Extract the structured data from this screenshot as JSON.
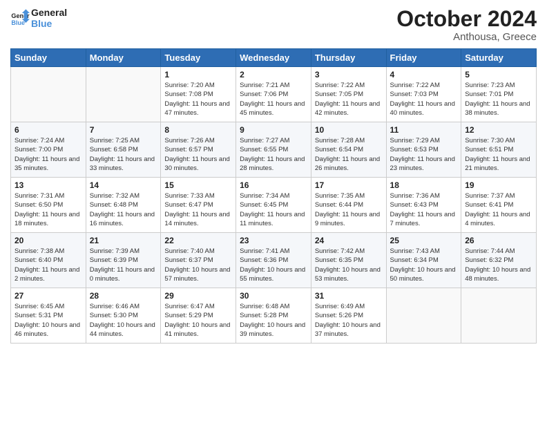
{
  "header": {
    "logo_line1": "General",
    "logo_line2": "Blue",
    "month": "October 2024",
    "location": "Anthousa, Greece"
  },
  "weekdays": [
    "Sunday",
    "Monday",
    "Tuesday",
    "Wednesday",
    "Thursday",
    "Friday",
    "Saturday"
  ],
  "weeks": [
    [
      {
        "day": "",
        "sunrise": "",
        "sunset": "",
        "daylight": ""
      },
      {
        "day": "",
        "sunrise": "",
        "sunset": "",
        "daylight": ""
      },
      {
        "day": "1",
        "sunrise": "Sunrise: 7:20 AM",
        "sunset": "Sunset: 7:08 PM",
        "daylight": "Daylight: 11 hours and 47 minutes."
      },
      {
        "day": "2",
        "sunrise": "Sunrise: 7:21 AM",
        "sunset": "Sunset: 7:06 PM",
        "daylight": "Daylight: 11 hours and 45 minutes."
      },
      {
        "day": "3",
        "sunrise": "Sunrise: 7:22 AM",
        "sunset": "Sunset: 7:05 PM",
        "daylight": "Daylight: 11 hours and 42 minutes."
      },
      {
        "day": "4",
        "sunrise": "Sunrise: 7:22 AM",
        "sunset": "Sunset: 7:03 PM",
        "daylight": "Daylight: 11 hours and 40 minutes."
      },
      {
        "day": "5",
        "sunrise": "Sunrise: 7:23 AM",
        "sunset": "Sunset: 7:01 PM",
        "daylight": "Daylight: 11 hours and 38 minutes."
      }
    ],
    [
      {
        "day": "6",
        "sunrise": "Sunrise: 7:24 AM",
        "sunset": "Sunset: 7:00 PM",
        "daylight": "Daylight: 11 hours and 35 minutes."
      },
      {
        "day": "7",
        "sunrise": "Sunrise: 7:25 AM",
        "sunset": "Sunset: 6:58 PM",
        "daylight": "Daylight: 11 hours and 33 minutes."
      },
      {
        "day": "8",
        "sunrise": "Sunrise: 7:26 AM",
        "sunset": "Sunset: 6:57 PM",
        "daylight": "Daylight: 11 hours and 30 minutes."
      },
      {
        "day": "9",
        "sunrise": "Sunrise: 7:27 AM",
        "sunset": "Sunset: 6:55 PM",
        "daylight": "Daylight: 11 hours and 28 minutes."
      },
      {
        "day": "10",
        "sunrise": "Sunrise: 7:28 AM",
        "sunset": "Sunset: 6:54 PM",
        "daylight": "Daylight: 11 hours and 26 minutes."
      },
      {
        "day": "11",
        "sunrise": "Sunrise: 7:29 AM",
        "sunset": "Sunset: 6:53 PM",
        "daylight": "Daylight: 11 hours and 23 minutes."
      },
      {
        "day": "12",
        "sunrise": "Sunrise: 7:30 AM",
        "sunset": "Sunset: 6:51 PM",
        "daylight": "Daylight: 11 hours and 21 minutes."
      }
    ],
    [
      {
        "day": "13",
        "sunrise": "Sunrise: 7:31 AM",
        "sunset": "Sunset: 6:50 PM",
        "daylight": "Daylight: 11 hours and 18 minutes."
      },
      {
        "day": "14",
        "sunrise": "Sunrise: 7:32 AM",
        "sunset": "Sunset: 6:48 PM",
        "daylight": "Daylight: 11 hours and 16 minutes."
      },
      {
        "day": "15",
        "sunrise": "Sunrise: 7:33 AM",
        "sunset": "Sunset: 6:47 PM",
        "daylight": "Daylight: 11 hours and 14 minutes."
      },
      {
        "day": "16",
        "sunrise": "Sunrise: 7:34 AM",
        "sunset": "Sunset: 6:45 PM",
        "daylight": "Daylight: 11 hours and 11 minutes."
      },
      {
        "day": "17",
        "sunrise": "Sunrise: 7:35 AM",
        "sunset": "Sunset: 6:44 PM",
        "daylight": "Daylight: 11 hours and 9 minutes."
      },
      {
        "day": "18",
        "sunrise": "Sunrise: 7:36 AM",
        "sunset": "Sunset: 6:43 PM",
        "daylight": "Daylight: 11 hours and 7 minutes."
      },
      {
        "day": "19",
        "sunrise": "Sunrise: 7:37 AM",
        "sunset": "Sunset: 6:41 PM",
        "daylight": "Daylight: 11 hours and 4 minutes."
      }
    ],
    [
      {
        "day": "20",
        "sunrise": "Sunrise: 7:38 AM",
        "sunset": "Sunset: 6:40 PM",
        "daylight": "Daylight: 11 hours and 2 minutes."
      },
      {
        "day": "21",
        "sunrise": "Sunrise: 7:39 AM",
        "sunset": "Sunset: 6:39 PM",
        "daylight": "Daylight: 11 hours and 0 minutes."
      },
      {
        "day": "22",
        "sunrise": "Sunrise: 7:40 AM",
        "sunset": "Sunset: 6:37 PM",
        "daylight": "Daylight: 10 hours and 57 minutes."
      },
      {
        "day": "23",
        "sunrise": "Sunrise: 7:41 AM",
        "sunset": "Sunset: 6:36 PM",
        "daylight": "Daylight: 10 hours and 55 minutes."
      },
      {
        "day": "24",
        "sunrise": "Sunrise: 7:42 AM",
        "sunset": "Sunset: 6:35 PM",
        "daylight": "Daylight: 10 hours and 53 minutes."
      },
      {
        "day": "25",
        "sunrise": "Sunrise: 7:43 AM",
        "sunset": "Sunset: 6:34 PM",
        "daylight": "Daylight: 10 hours and 50 minutes."
      },
      {
        "day": "26",
        "sunrise": "Sunrise: 7:44 AM",
        "sunset": "Sunset: 6:32 PM",
        "daylight": "Daylight: 10 hours and 48 minutes."
      }
    ],
    [
      {
        "day": "27",
        "sunrise": "Sunrise: 6:45 AM",
        "sunset": "Sunset: 5:31 PM",
        "daylight": "Daylight: 10 hours and 46 minutes."
      },
      {
        "day": "28",
        "sunrise": "Sunrise: 6:46 AM",
        "sunset": "Sunset: 5:30 PM",
        "daylight": "Daylight: 10 hours and 44 minutes."
      },
      {
        "day": "29",
        "sunrise": "Sunrise: 6:47 AM",
        "sunset": "Sunset: 5:29 PM",
        "daylight": "Daylight: 10 hours and 41 minutes."
      },
      {
        "day": "30",
        "sunrise": "Sunrise: 6:48 AM",
        "sunset": "Sunset: 5:28 PM",
        "daylight": "Daylight: 10 hours and 39 minutes."
      },
      {
        "day": "31",
        "sunrise": "Sunrise: 6:49 AM",
        "sunset": "Sunset: 5:26 PM",
        "daylight": "Daylight: 10 hours and 37 minutes."
      },
      {
        "day": "",
        "sunrise": "",
        "sunset": "",
        "daylight": ""
      },
      {
        "day": "",
        "sunrise": "",
        "sunset": "",
        "daylight": ""
      }
    ]
  ]
}
